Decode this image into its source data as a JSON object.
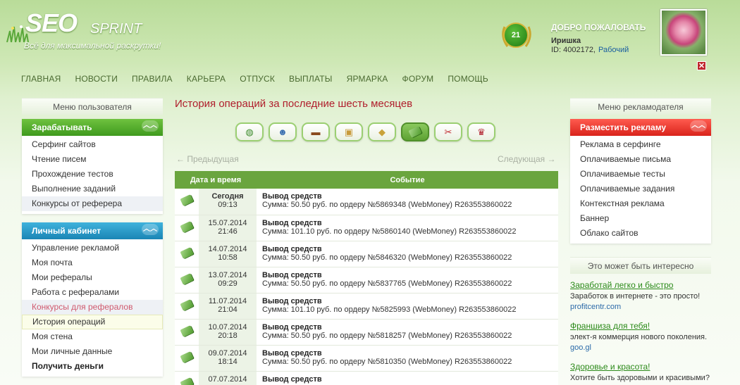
{
  "header": {
    "logo_main": "SEO",
    "logo_sprint": "SPRINT",
    "tagline": "Всё для максимальной раскрутки!",
    "level": "21",
    "welcome": "ДОБРО ПОЖАЛОВАТЬ",
    "username": "Иришка",
    "user_id": "ID: 4002172,",
    "status_link": "Рабочий",
    "close": "✕"
  },
  "nav": [
    "ГЛАВНАЯ",
    "НОВОСТИ",
    "ПРАВИЛА",
    "КАРЬЕРА",
    "ОТПУСК",
    "ВЫПЛАТЫ",
    "ЯРМАРКА",
    "ФОРУМ",
    "ПОМОЩЬ"
  ],
  "left": {
    "heading": "Меню пользователя",
    "earn": {
      "title": "Зарабатывать",
      "items": [
        "Серфинг сайтов",
        "Чтение писем",
        "Прохождение тестов",
        "Выполнение заданий",
        "Конкурсы от реферера"
      ]
    },
    "cabinet": {
      "title": "Личный кабинет",
      "items": [
        "Управление рекламой",
        "Моя почта",
        "Мои рефералы",
        "Работа с рефералами",
        "Конкурсы для рефералов",
        "История операций",
        "Моя стена",
        "Мои личные данные",
        "Получить деньги"
      ]
    }
  },
  "center": {
    "title": "История операций за последние шесть месяцев",
    "prev": "← Предыдущая",
    "next": "Следующая →",
    "columns": [
      "Дата и время",
      "Событие"
    ],
    "rows": [
      {
        "date": "Сегодня",
        "time": "09:13",
        "event": "Вывод средств",
        "detail": "Сумма: 50.50 руб. по ордеру №5869348 (WebMoney) R263553860022"
      },
      {
        "date": "15.07.2014",
        "time": "21:46",
        "event": "Вывод средств",
        "detail": "Сумма: 101.10 руб. по ордеру №5860140 (WebMoney) R263553860022"
      },
      {
        "date": "14.07.2014",
        "time": "10:58",
        "event": "Вывод средств",
        "detail": "Сумма: 50.50 руб. по ордеру №5846320 (WebMoney) R263553860022"
      },
      {
        "date": "13.07.2014",
        "time": "09:29",
        "event": "Вывод средств",
        "detail": "Сумма: 50.50 руб. по ордеру №5837765 (WebMoney) R263553860022"
      },
      {
        "date": "11.07.2014",
        "time": "21:04",
        "event": "Вывод средств",
        "detail": "Сумма: 101.10 руб. по ордеру №5825993 (WebMoney) R263553860022"
      },
      {
        "date": "10.07.2014",
        "time": "20:18",
        "event": "Вывод средств",
        "detail": "Сумма: 50.50 руб. по ордеру №5818257 (WebMoney) R263553860022"
      },
      {
        "date": "09.07.2014",
        "time": "18:14",
        "event": "Вывод средств",
        "detail": "Сумма: 50.50 руб. по ордеру №5810350 (WebMoney) R263553860022"
      },
      {
        "date": "07.07.2014",
        "time": "",
        "event": "Вывод средств",
        "detail": ""
      }
    ]
  },
  "right": {
    "heading": "Меню рекламодателя",
    "place_ad": {
      "title": "Разместить рекламу",
      "items": [
        "Реклама в серфинге",
        "Оплачиваемые письма",
        "Оплачиваемые тесты",
        "Оплачиваемые задания",
        "Контекстная реклама",
        "Баннер",
        "Облако сайтов"
      ]
    },
    "interesting": "Это может быть интересно",
    "ads": [
      {
        "title": "Заработай легко и быстро",
        "text": "Заработок в интернете - это просто!",
        "url": "profitcentr.com"
      },
      {
        "title": "Франшиза для тебя!",
        "text": "элект-я коммерция нового поколения.",
        "url": "goo.gl"
      },
      {
        "title": "Здоровье и красота!",
        "text": "Хотите быть здоровыми и красивыми?",
        "url": ""
      }
    ]
  }
}
